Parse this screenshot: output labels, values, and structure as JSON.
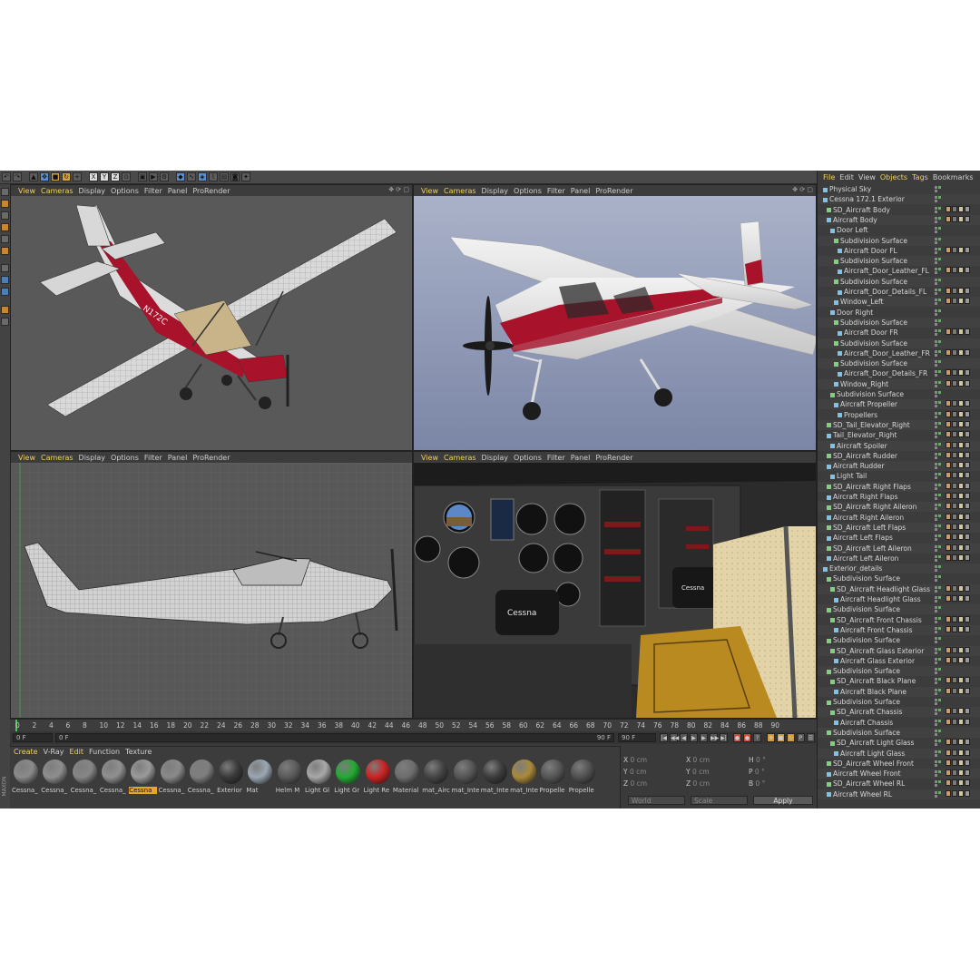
{
  "viewport_menu": [
    "View",
    "Cameras",
    "Display",
    "Options",
    "Filter",
    "Panel",
    "ProRender"
  ],
  "viewports": [
    {
      "name": "perspective-wireframe"
    },
    {
      "name": "perspective-render"
    },
    {
      "name": "side-wireframe"
    },
    {
      "name": "cockpit-render"
    }
  ],
  "aircraft": {
    "tail_number": "N172C",
    "brand": "Cessna"
  },
  "timeline": {
    "ticks": [
      "0",
      "2",
      "4",
      "6",
      "8",
      "10",
      "12",
      "14",
      "16",
      "18",
      "20",
      "22",
      "24",
      "26",
      "28",
      "30",
      "32",
      "34",
      "36",
      "38",
      "40",
      "42",
      "44",
      "46",
      "48",
      "50",
      "52",
      "54",
      "56",
      "58",
      "60",
      "62",
      "64",
      "66",
      "68",
      "70",
      "72",
      "74",
      "76",
      "78",
      "80",
      "82",
      "84",
      "86",
      "88",
      "90"
    ],
    "current_frame": "0 F",
    "start_frame": "0 F",
    "end_frame": "90 F",
    "max_frame": "90 F",
    "frame_readout": "0 F"
  },
  "material_menu": {
    "items": [
      "Create",
      "V-Ray",
      "Edit",
      "Function",
      "Texture"
    ],
    "active": "Edit"
  },
  "materials": [
    {
      "label": "Cessna_",
      "color": "#8a8a8a"
    },
    {
      "label": "Cessna_",
      "color": "#8e8e8e"
    },
    {
      "label": "Cessna_",
      "color": "#868686"
    },
    {
      "label": "Cessna_",
      "color": "#909090"
    },
    {
      "label": "Cessna",
      "color": "#9a9a9a",
      "selected": true
    },
    {
      "label": "Cessna_",
      "color": "#8a8a8a"
    },
    {
      "label": "Cessna_",
      "color": "#7e7e7e"
    },
    {
      "label": "Exterior",
      "color": "#3a3a3a"
    },
    {
      "label": "Mat",
      "color": "#9aa7b3"
    },
    {
      "label": "Helm M",
      "color": "#5a5a5a"
    },
    {
      "label": "Light Gl",
      "color": "#a8a8a8"
    },
    {
      "label": "Light Gr",
      "color": "#22aa33"
    },
    {
      "label": "Light Re",
      "color": "#cc2222"
    },
    {
      "label": "Material",
      "color": "#6d6d6d"
    },
    {
      "label": "mat_Airc",
      "color": "#444444"
    },
    {
      "label": "mat_Inte",
      "color": "#555555"
    },
    {
      "label": "mat_Inte",
      "color": "#3c3c3c"
    },
    {
      "label": "mat_Inte",
      "color": "#a98a3a"
    },
    {
      "label": "Propelle",
      "color": "#555555"
    },
    {
      "label": "Propelle",
      "color": "#505050"
    }
  ],
  "coordinates": {
    "position": [
      {
        "axis": "X",
        "value": "0 cm"
      },
      {
        "axis": "Y",
        "value": "0 cm"
      },
      {
        "axis": "Z",
        "value": "0 cm"
      }
    ],
    "size": [
      {
        "axis": "X",
        "value": "0 cm"
      },
      {
        "axis": "Y",
        "value": "0 cm"
      },
      {
        "axis": "Z",
        "value": "0 cm"
      }
    ],
    "rotation": [
      {
        "axis": "H",
        "value": "0 °"
      },
      {
        "axis": "P",
        "value": "0 °"
      },
      {
        "axis": "B",
        "value": "0 °"
      }
    ],
    "mode_world": "World",
    "mode_scale": "Scale",
    "apply_label": "Apply"
  },
  "object_menu": {
    "items": [
      "File",
      "Edit",
      "View",
      "Objects",
      "Tags",
      "Bookmarks"
    ],
    "active": "Objects"
  },
  "objects": [
    {
      "name": "Physical Sky",
      "depth": 0
    },
    {
      "name": "Cessna 172.1 Exterior",
      "depth": 0
    },
    {
      "name": "SD_Aircraft Body",
      "depth": 1
    },
    {
      "name": "Aircraft Body",
      "depth": 1
    },
    {
      "name": "Door Left",
      "depth": 2
    },
    {
      "name": "Subdivision Surface",
      "depth": 3
    },
    {
      "name": "Aircraft Door FL",
      "depth": 4
    },
    {
      "name": "Subdivision Surface",
      "depth": 3
    },
    {
      "name": "Aircraft_Door_Leather_FL",
      "depth": 4
    },
    {
      "name": "Subdivision Surface",
      "depth": 3
    },
    {
      "name": "Aircraft_Door_Details_FL",
      "depth": 4
    },
    {
      "name": "Window_Left",
      "depth": 3
    },
    {
      "name": "Door Right",
      "depth": 2
    },
    {
      "name": "Subdivision Surface",
      "depth": 3
    },
    {
      "name": "Aircraft Door FR",
      "depth": 4
    },
    {
      "name": "Subdivision Surface",
      "depth": 3
    },
    {
      "name": "Aircraft_Door_Leather_FR",
      "depth": 4
    },
    {
      "name": "Subdivision Surface",
      "depth": 3
    },
    {
      "name": "Aircraft_Door_Details_FR",
      "depth": 4
    },
    {
      "name": "Window_Right",
      "depth": 3
    },
    {
      "name": "Subdivision Surface",
      "depth": 2
    },
    {
      "name": "Aircraft Propeller",
      "depth": 3
    },
    {
      "name": "Propellers",
      "depth": 4
    },
    {
      "name": "SD_Tail_Elevator_Right",
      "depth": 1
    },
    {
      "name": "Tail_Elevator_Right",
      "depth": 1
    },
    {
      "name": "Aircraft Spoiler",
      "depth": 2
    },
    {
      "name": "SD_Aircraft Rudder",
      "depth": 1
    },
    {
      "name": "Aircraft Rudder",
      "depth": 1
    },
    {
      "name": "Light Tail",
      "depth": 2
    },
    {
      "name": "SD_Aircraft Right Flaps",
      "depth": 1
    },
    {
      "name": "Aircraft Right Flaps",
      "depth": 1
    },
    {
      "name": "SD_Aircraft Right Aileron",
      "depth": 1
    },
    {
      "name": "Aircraft Right Aileron",
      "depth": 1
    },
    {
      "name": "SD_Aircraft Left Flaps",
      "depth": 1
    },
    {
      "name": "Aircraft Left Flaps",
      "depth": 1
    },
    {
      "name": "SD_Aircraft Left Aileron",
      "depth": 1
    },
    {
      "name": "Aircraft Left Aileron",
      "depth": 1
    },
    {
      "name": "Exterior_details",
      "depth": 0
    },
    {
      "name": "Subdivision Surface",
      "depth": 1
    },
    {
      "name": "SD_Aircraft Headlight Glass",
      "depth": 2
    },
    {
      "name": "Aircraft Headlight Glass",
      "depth": 3
    },
    {
      "name": "Subdivision Surface",
      "depth": 1
    },
    {
      "name": "SD_Aircraft Front Chassis",
      "depth": 2
    },
    {
      "name": "Aircraft Front Chassis",
      "depth": 3
    },
    {
      "name": "Subdivision Surface",
      "depth": 1
    },
    {
      "name": "SD_Aircraft Glass Exterior",
      "depth": 2
    },
    {
      "name": "Aircraft Glass Exterior",
      "depth": 3
    },
    {
      "name": "Subdivision Surface",
      "depth": 1
    },
    {
      "name": "SD_Aircraft Black Plane",
      "depth": 2
    },
    {
      "name": "Aircraft Black Plane",
      "depth": 3
    },
    {
      "name": "Subdivision Surface",
      "depth": 1
    },
    {
      "name": "SD_Aircraft Chassis",
      "depth": 2
    },
    {
      "name": "Aircraft Chassis",
      "depth": 3
    },
    {
      "name": "Subdivision Surface",
      "depth": 1
    },
    {
      "name": "SD_Aircraft Light Glass",
      "depth": 2
    },
    {
      "name": "Aircraft Light Glass",
      "depth": 3
    },
    {
      "name": "SD_Aircraft Wheel Front",
      "depth": 1
    },
    {
      "name": "Aircraft Wheel Front",
      "depth": 1
    },
    {
      "name": "SD_Aircraft Wheel RL",
      "depth": 1
    },
    {
      "name": "Aircraft Wheel RL",
      "depth": 1
    }
  ],
  "colors": {
    "accent": "#f0d060",
    "selection": "#e8a52a",
    "panel": "#3c3c3c",
    "viewport_bg": "#5c5c5c",
    "render_bg": "#8c97b5",
    "aircraft_red": "#a8122a",
    "playhead": "#3bd14a"
  }
}
